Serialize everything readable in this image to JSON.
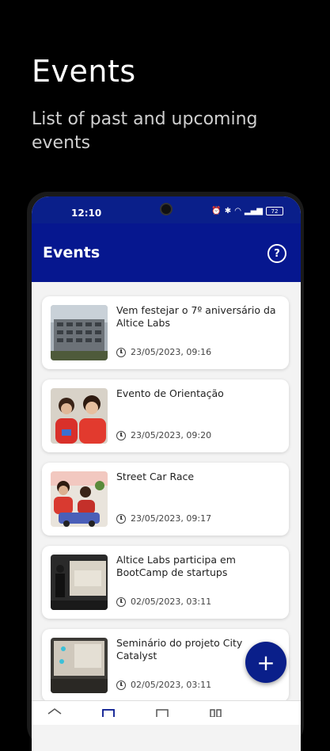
{
  "promo": {
    "title": "Events",
    "subtitle": "List of past and upcoming events"
  },
  "status_bar": {
    "time": "12:10",
    "battery": "72"
  },
  "app_bar": {
    "title": "Events",
    "help_icon": "help-circle-icon"
  },
  "events": [
    {
      "title": "Vem festejar o 7º aniversário da Altice Labs",
      "date": "23/05/2023, 09:16",
      "thumb": "building"
    },
    {
      "title": "Evento de Orientação",
      "date": "23/05/2023, 09:20",
      "thumb": "people-red"
    },
    {
      "title": "Street Car Race",
      "date": "23/05/2023, 09:17",
      "thumb": "car-race"
    },
    {
      "title": "Altice Labs participa em BootCamp de startups",
      "date": "02/05/2023, 03:11",
      "thumb": "presentation"
    },
    {
      "title": "Seminário do projeto City Catalyst",
      "date": "02/05/2023, 03:11",
      "thumb": "seminar"
    }
  ],
  "fab": {
    "label": "+"
  },
  "colors": {
    "primary": "#06178f",
    "background": "#000000"
  }
}
